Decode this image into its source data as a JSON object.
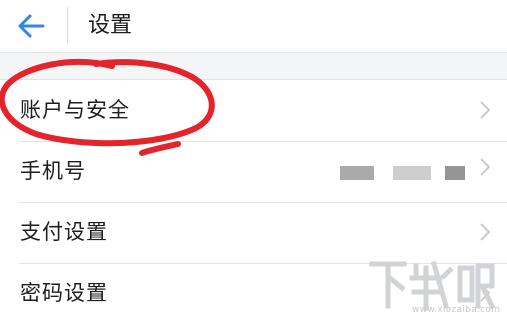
{
  "header": {
    "back_icon": "arrow-left-icon",
    "title": "设置",
    "accent_color": "#2f86e6"
  },
  "settings": {
    "items": [
      {
        "label": "账户与安全",
        "icon": "chevron-right-icon"
      },
      {
        "label": "手机号",
        "value_masked": true,
        "icon": "chevron-right-icon"
      },
      {
        "label": "支付设置",
        "icon": "chevron-right-icon"
      },
      {
        "label": "密码设置",
        "icon": "chevron-right-icon"
      }
    ]
  },
  "annotation": {
    "shape": "hand-drawn ellipse around first item",
    "color": "#e5232b"
  },
  "watermark": {
    "logo_text": "下载吧",
    "url": "www.xiazaiba.com"
  }
}
